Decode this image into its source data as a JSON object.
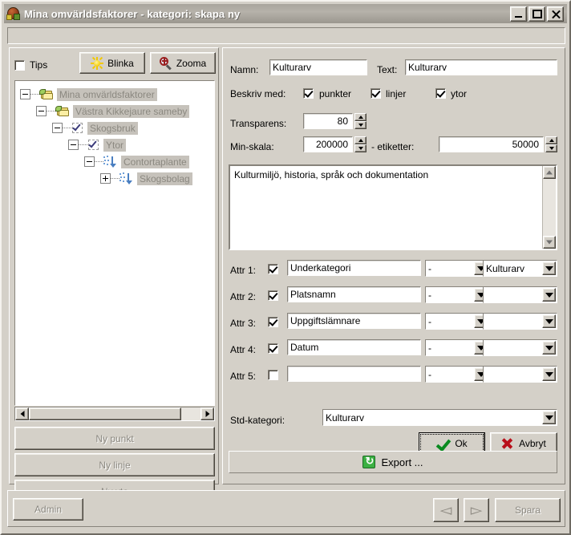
{
  "window": {
    "title": "Mina omvärldsfaktorer - kategori: skapa ny",
    "minimize_label": "Minimize",
    "maximize_label": "Maximize",
    "close_label": "Close"
  },
  "left_panel": {
    "tips_label": "Tips",
    "tips_checked": false,
    "blinka_label": "Blinka",
    "zooma_label": "Zooma",
    "tree": [
      {
        "label": "Mina omvärldsfaktorer",
        "indent": 0,
        "expander": "minus",
        "icon": "folder-globe-icon"
      },
      {
        "label": "Västra Kikkejaure sameby",
        "indent": 1,
        "expander": "minus",
        "icon": "folder-globe-icon"
      },
      {
        "label": "Skogsbruk",
        "indent": 2,
        "expander": "minus",
        "icon": "checkbox-check-icon"
      },
      {
        "label": "Ytor",
        "indent": 3,
        "expander": "minus",
        "icon": "checkbox-check-icon"
      },
      {
        "label": "Contortaplante",
        "indent": 4,
        "expander": "minus",
        "icon": "points-arrow-icon"
      },
      {
        "label": "Skogsbolag",
        "indent": 5,
        "expander": "plus",
        "icon": "points-arrow-icon"
      }
    ],
    "buttons": {
      "ny_punkt": "Ny punkt",
      "ny_linje": "Ny linje",
      "ny_yta": "Ny yta"
    }
  },
  "form": {
    "namn_label": "Namn:",
    "namn_value": "Kulturarv",
    "text_label": "Text:",
    "text_value": "Kulturarv",
    "beskriv_label": "Beskriv med:",
    "beskriv_options": [
      {
        "label": "punkter",
        "checked": true
      },
      {
        "label": "linjer",
        "checked": true
      },
      {
        "label": "ytor",
        "checked": true
      }
    ],
    "transparens_label": "Transparens:",
    "transparens_value": "80",
    "minskala_label": "Min-skala:",
    "minskala_value": "200000",
    "etiketter_label": "- etiketter:",
    "etiketter_value": "50000",
    "description_text": "Kulturmiljö, historia, språk och dokumentation",
    "attributes": [
      {
        "label": "Attr 1:",
        "checked": true,
        "name": "Underkategori",
        "op": "-",
        "value": "Kulturarv"
      },
      {
        "label": "Attr 2:",
        "checked": true,
        "name": "Platsnamn",
        "op": "-",
        "value": ""
      },
      {
        "label": "Attr 3:",
        "checked": true,
        "name": "Uppgiftslämnare",
        "op": "-",
        "value": ""
      },
      {
        "label": "Attr 4:",
        "checked": true,
        "name": "Datum",
        "op": "-",
        "value": ""
      },
      {
        "label": "Attr 5:",
        "checked": false,
        "name": "",
        "op": "-",
        "value": ""
      }
    ],
    "std_kategori_label": "Std-kategori:",
    "std_kategori_value": "Kulturarv",
    "ok_label": "Ok",
    "avbryt_label": "Avbryt",
    "export_label": "Export ..."
  },
  "footer": {
    "admin_label": "Admin",
    "prev_label": "◅",
    "next_label": "▻",
    "spara_label": "Spara"
  }
}
